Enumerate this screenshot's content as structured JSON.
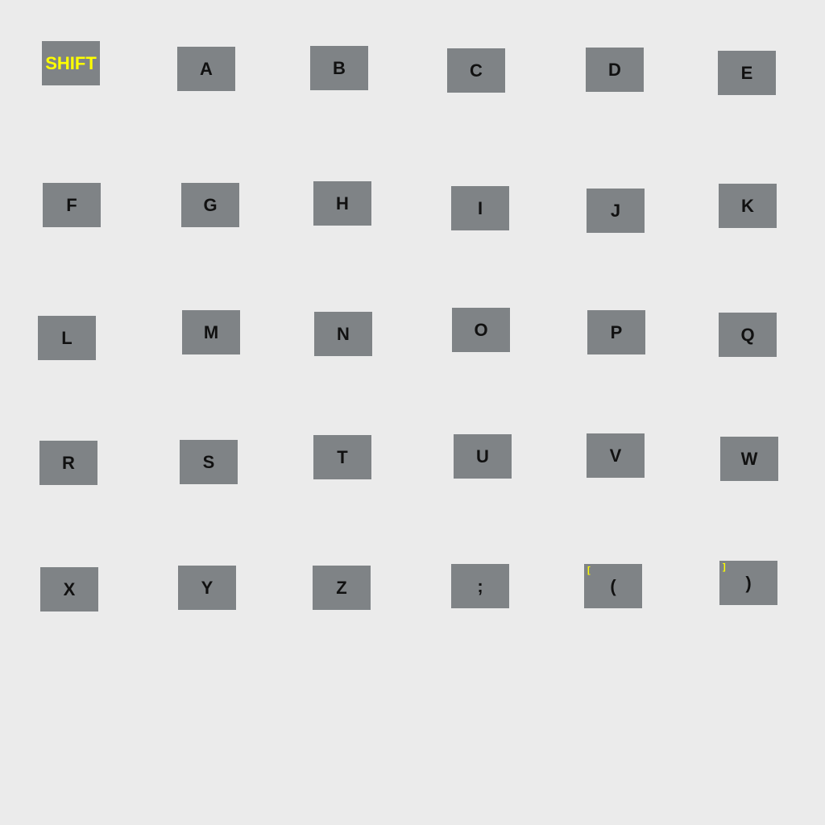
{
  "keyboard": {
    "shift_label": "SHIFT",
    "keys": [
      "A",
      "B",
      "C",
      "D",
      "E",
      "F",
      "G",
      "H",
      "I",
      "J",
      "K",
      "L",
      "M",
      "N",
      "O",
      "P",
      "Q",
      "R",
      "S",
      "T",
      "U",
      "V",
      "W",
      "X",
      "Y",
      "Z",
      ";",
      "(",
      ")"
    ],
    "alt_labels": {
      "lparen": "[",
      "rparen": "]"
    }
  },
  "colors": {
    "background": "#ebebeb",
    "key_fill": "#7f8386",
    "key_text": "#111111",
    "shift_text": "#ffff00",
    "alt_text": "#ffff00"
  }
}
